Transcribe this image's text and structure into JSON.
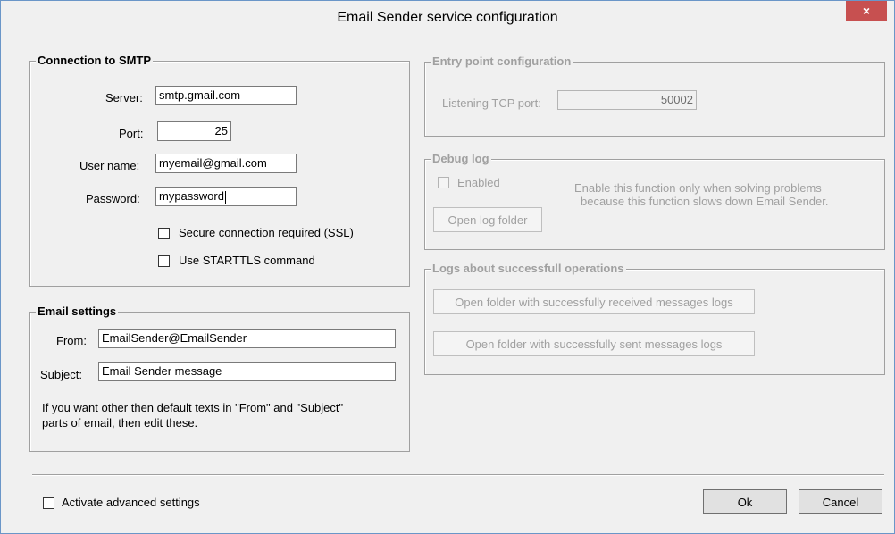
{
  "window": {
    "title": "Email Sender service configuration",
    "close_icon": "×"
  },
  "smtp": {
    "legend": "Connection to SMTP",
    "server_label": "Server:",
    "server_value": "smtp.gmail.com",
    "port_label": "Port:",
    "port_value": "25",
    "username_label": "User name:",
    "username_value": "myemail@gmail.com",
    "password_label": "Password:",
    "password_value": "mypassword",
    "ssl_label": "Secure connection required (SSL)",
    "ssl_checked": false,
    "starttls_label": "Use STARTTLS command",
    "starttls_checked": false
  },
  "email": {
    "legend": "Email settings",
    "from_label": "From:",
    "from_value": "EmailSender@EmailSender",
    "subject_label": "Subject:",
    "subject_value": "Email Sender message",
    "note_line1": "If you want other then default texts in \"From\" and \"Subject\"",
    "note_line2": "parts of email, then edit these."
  },
  "entry": {
    "legend": "Entry point configuration",
    "port_label": "Listening TCP port:",
    "port_value": "50002"
  },
  "debug": {
    "legend": "Debug log",
    "enabled_label": "Enabled",
    "enabled_checked": false,
    "note_line1": "Enable this function only when solving problems",
    "note_line2": "because this function slows down Email Sender.",
    "open_log_button": "Open log folder"
  },
  "logs": {
    "legend": "Logs about successfull operations",
    "received_button": "Open folder with successfully received messages logs",
    "sent_button": "Open folder with successfully sent messages logs"
  },
  "footer": {
    "advanced_label": "Activate advanced settings",
    "advanced_checked": false,
    "ok_button": "Ok",
    "cancel_button": "Cancel"
  }
}
